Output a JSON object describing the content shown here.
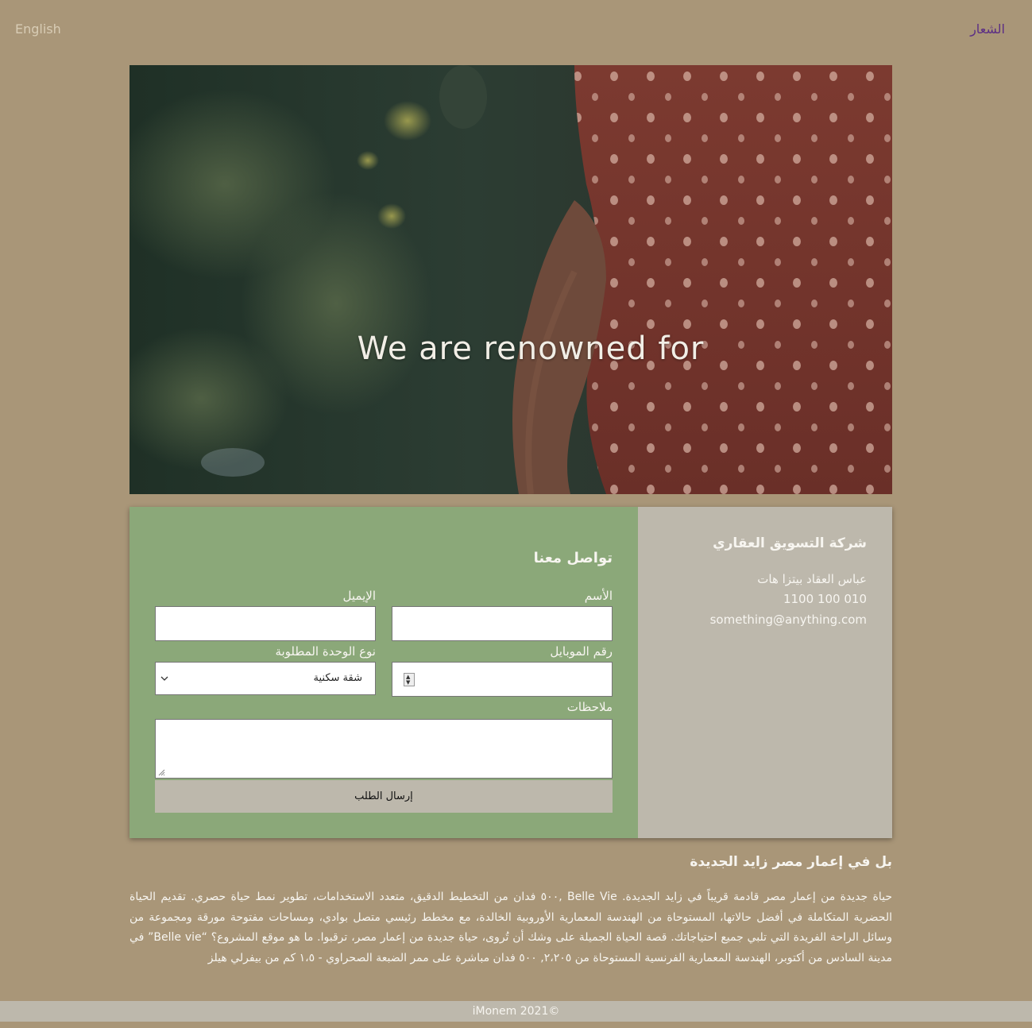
{
  "header": {
    "language_link": "English",
    "logo_link": "الشعار"
  },
  "hero": {
    "caption": "We are renowned for"
  },
  "company": {
    "name": "شركة التسويق العقاري",
    "address": "عباس العقاد بيتزا هات",
    "phone": "010 100 1100",
    "email": "something@anything.com"
  },
  "form": {
    "title": "تواصل معنا",
    "name_label": "الأسم",
    "email_label": "الإيميل",
    "mobile_label": "رقم الموبايل",
    "unit_type_label": "نوع الوحدة المطلوبة",
    "unit_type_selected": "شقة سكنية",
    "notes_label": "ملاحظات",
    "submit_label": "إرسال الطلب"
  },
  "about": {
    "title": "بل في إعمار مصر زايد الجديدة",
    "body": "حياة جديدة من إعمار مصر قادمة قريباً في زايد الجديدة. Belle Vie ,٥٠٠ فدان من التخطيط الدقيق، متعدد الاستخدامات، تطوير نمط حياة حصري. تقديم الحياة الحضرية المتكاملة في أفضل حالاتها، المستوحاة من الهندسة المعمارية الأوروبية الخالدة، مع مخطط رئيسي متصل بوادي، ومساحات مفتوحة مورقة ومجموعة من وسائل الراحة الفريدة التي تلبي جميع احتياجاتك. قصة الحياة الجميلة على وشك أن تُروى، حياة جديدة من إعمار مصر، ترقبوا. ما هو موقع المشروع؟ “Belle vie” في مدينة السادس من أكتوبر، الهندسة المعمارية الفرنسية المستوحاة من ٢،٢٠٥, ٥٠٠ فدان مباشرة على ممر الضبعة الصحراوي - ١،٥ كم من بيفرلي هيلز"
  },
  "footer": {
    "copyright": "iMonem 2021©"
  },
  "colors": {
    "page_background": "#a99678",
    "form_panel": "#8ba879",
    "info_panel": "#bdb8ac",
    "logo_link": "#5b2d85"
  }
}
